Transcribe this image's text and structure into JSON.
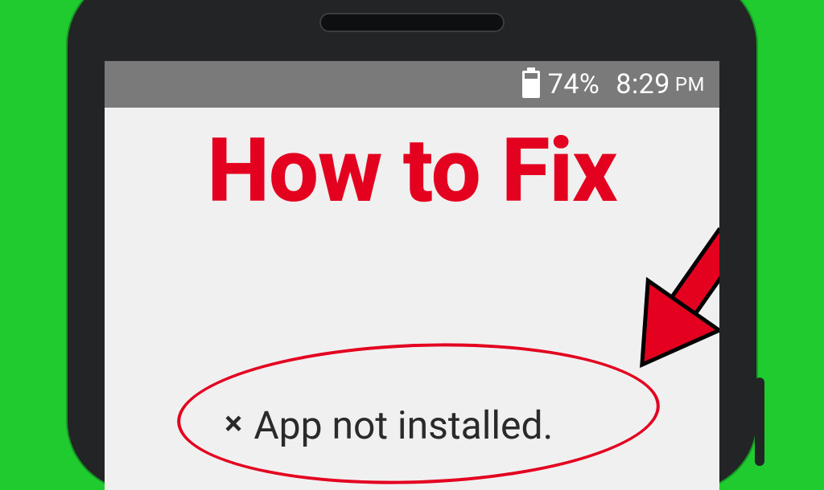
{
  "statusbar": {
    "battery_pct": "74%",
    "time": "8:29",
    "ampm": "PM"
  },
  "title": "How to Fix",
  "message": {
    "x": "×",
    "text": "App not installed."
  }
}
